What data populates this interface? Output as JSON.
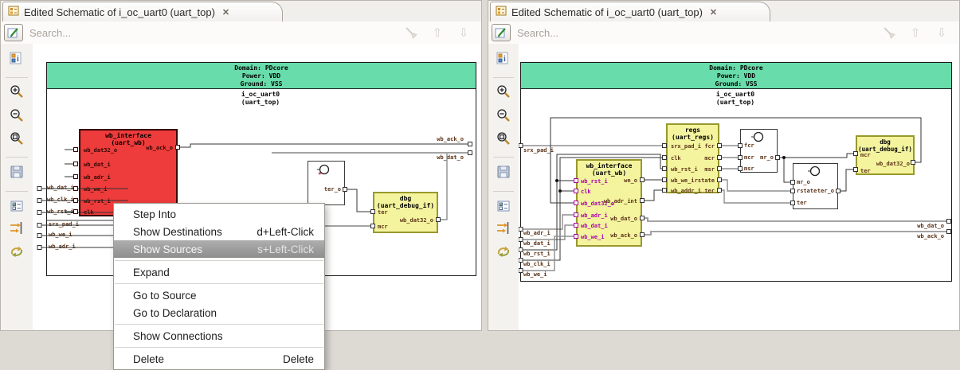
{
  "tab": {
    "title": "Edited Schematic of i_oc_uart0 (uart_top)"
  },
  "icons": {
    "close": "✕",
    "up_arrow": "⇧",
    "down_arrow": "⇩"
  },
  "search": {
    "placeholder": "Search..."
  },
  "banner": {
    "domain": "Domain: PDcore",
    "power": "Power: VDD",
    "ground": "Ground: VSS",
    "instance": "i_oc_uart0",
    "module": "(uart_top)"
  },
  "colors": {
    "banner_green": "#68dcaa",
    "selected_block_red": "#ee3b3b",
    "block_yellow": "#f4f49f",
    "pin_highlight_magenta": "#a800a8",
    "menu_highlight_gray": "#9a9a9a"
  },
  "context_menu": {
    "items": [
      {
        "label": "Step Into",
        "shortcut": ""
      },
      {
        "label": "Show Destinations",
        "shortcut": "d+Left-Click"
      },
      {
        "label": "Show Sources",
        "shortcut": "s+Left-Click"
      },
      {
        "label": "Expand",
        "shortcut": ""
      },
      {
        "label": "Go to Source",
        "shortcut": ""
      },
      {
        "label": "Go to Declaration",
        "shortcut": ""
      },
      {
        "label": "Show Connections",
        "shortcut": ""
      },
      {
        "label": "Delete",
        "shortcut": "Delete"
      }
    ]
  },
  "left_pane": {
    "ports_in_upper": [
      "wb_dat_i",
      "wb_clk_i",
      "wb_rst_i"
    ],
    "ports_in_lower": [
      "srx_pad_i",
      "wb_we_i",
      "wb_adr_i"
    ],
    "ports_out": [
      "wb_ack_o",
      "wb_dat_o"
    ],
    "wb_interface": {
      "name": "wb_interface",
      "module": "(uart_wb)",
      "pins_left": [
        "wb_dat32_o",
        "wb_dat_i",
        "wb_adr_i",
        "wb_we_i",
        "wb_rst_i",
        "clk"
      ],
      "pins_right": [
        "wb_ack_o"
      ]
    },
    "logic": {
      "pin_out": "ter_o",
      "mark": "*"
    },
    "dbg": {
      "name": "dbg",
      "module": "(uart_debug_if)",
      "pins_left": [
        "ter",
        "mcr"
      ],
      "pins_right": [
        "wb_dat32_o"
      ]
    }
  },
  "right_pane": {
    "ports_in_upper": [
      "srx_pad_i"
    ],
    "ports_in_lower": [
      "wb_adr_i",
      "wb_dat_i",
      "wb_rst_i",
      "wb_clk_i",
      "wb_we_i"
    ],
    "ports_out": [
      "wb_dat_o",
      "wb_ack_o"
    ],
    "wb_interface": {
      "name": "wb_interface",
      "module": "(uart_wb)",
      "pins_left": [
        "wb_rst_i",
        "clk",
        "wb_dat32_o",
        "wb_adr_i",
        "wb_dat_i",
        "wb_we_i"
      ],
      "pins_right": [
        "we_o",
        "wb_adr_int",
        "wb_dat_o",
        "wb_ack_o"
      ]
    },
    "regs": {
      "name": "regs",
      "module": "(uart_regs)",
      "pins_left": [
        "srx_pad_i",
        "clk",
        "wb_rst_i",
        "wb_we_i",
        "wb_addr_i"
      ],
      "pins_right": [
        "fcr",
        "mcr",
        "msr",
        "rstate",
        "ter"
      ]
    },
    "logic1": {
      "pins_left": [
        "fcr",
        "mcr",
        "msr"
      ],
      "pins_right": [
        "mr_o"
      ]
    },
    "logic2": {
      "pins_left": [
        "mr_o",
        "rstate",
        "ter"
      ],
      "pins_right": [
        "ter_o"
      ]
    },
    "dbg": {
      "name": "dbg",
      "module": "(uart_debug_if)",
      "pins_left": [
        "mcr",
        "ter"
      ],
      "pins_right": [
        "wb_dat32_o"
      ]
    }
  }
}
